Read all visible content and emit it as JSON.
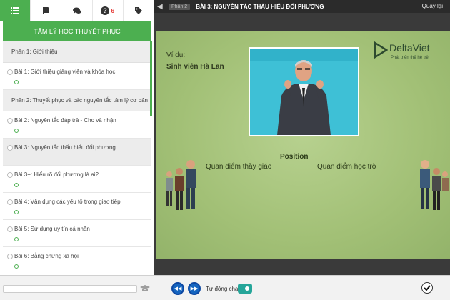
{
  "sidebar": {
    "tabs": [
      {
        "icon": "list-icon"
      },
      {
        "icon": "book-icon"
      },
      {
        "icon": "chat-icon"
      },
      {
        "icon": "question-icon",
        "badge": "6"
      },
      {
        "icon": "tag-icon"
      }
    ],
    "course_title": "TÂM LÝ HỌC THUYẾT PHỤC",
    "items": [
      {
        "type": "section",
        "label": "Phần 1: Giới thiệu"
      },
      {
        "type": "lesson",
        "label": "Bài 1: Giới thiệu giảng viên và khóa học"
      },
      {
        "type": "section",
        "label": "Phần 2: Thuyết phục và các nguyên tắc tâm lý cơ bản"
      },
      {
        "type": "lesson",
        "label": "Bài 2: Nguyên tắc đáp trả - Cho và nhận"
      },
      {
        "type": "lesson",
        "label": "Bài 3: Nguyên tắc thấu hiểu đối phương",
        "selected": true
      },
      {
        "type": "lesson",
        "label": "Bài 3+: Hiểu rõ đối phương là ai?"
      },
      {
        "type": "lesson",
        "label": "Bài 4: Vận dụng các yếu tố trong giao tiếp"
      },
      {
        "type": "lesson",
        "label": "Bài 5: Sử dụng uy tín cá nhân"
      },
      {
        "type": "lesson",
        "label": "Bài 6: Bằng chứng xã hội"
      }
    ]
  },
  "topbar": {
    "part": "Phần 2",
    "lesson_title": "BÀI 3: NGUYÊN TẮC THẤU HIỂU ĐỐI PHƯƠNG",
    "return_label": "Quay lại"
  },
  "slide": {
    "example_label": "Ví dụ:",
    "example_title": "Sinh viên Hà Lan",
    "logo_name": "DeltaViet",
    "logo_tagline": "Phát triển thế hệ trẻ",
    "position_word": "Position",
    "view_teacher": "Quan điểm thầy giáo",
    "view_student": "Quan điểm học trò"
  },
  "bottombar": {
    "autoplay_label": "Tự động chạy",
    "autoplay_on": true,
    "progress": 0.0
  },
  "colors": {
    "accent": "#4caf50",
    "slide_bg": "#a8c57e",
    "video_bg": "#3ec0d6",
    "nav_button": "#1565c0"
  }
}
